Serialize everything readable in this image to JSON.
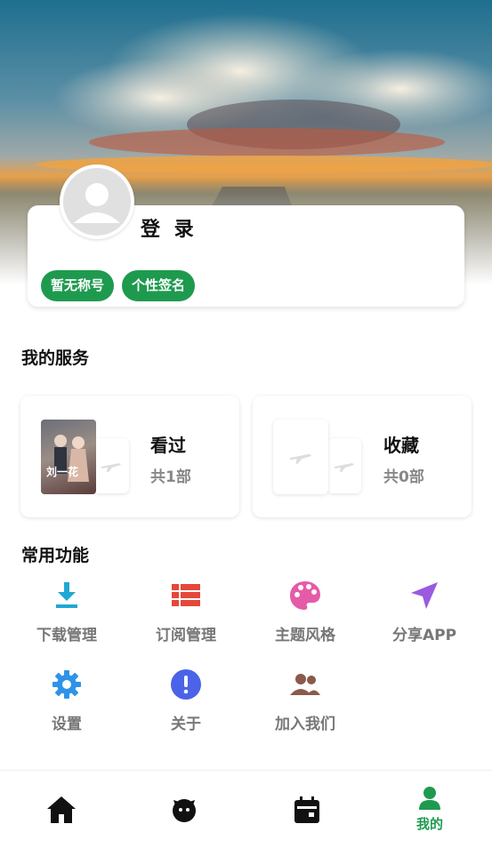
{
  "profile": {
    "login_label": "登 录",
    "chips": [
      "暂无称号",
      "个性签名"
    ]
  },
  "services": {
    "title": "我的服务",
    "items": [
      {
        "label": "看过",
        "count": "共1部",
        "poster_text": "刘一花"
      },
      {
        "label": "收藏",
        "count": "共0部"
      }
    ]
  },
  "functions": {
    "title": "常用功能",
    "items": [
      {
        "label": "下载管理",
        "icon": "download-icon",
        "color": "#1fa8d4"
      },
      {
        "label": "订阅管理",
        "icon": "list-icon",
        "color": "#e5483a"
      },
      {
        "label": "主题风格",
        "icon": "palette-icon",
        "color": "#e55ba8"
      },
      {
        "label": "分享APP",
        "icon": "send-icon",
        "color": "#9a5ae0"
      },
      {
        "label": "设置",
        "icon": "gear-icon",
        "color": "#2e93e8"
      },
      {
        "label": "关于",
        "icon": "info-icon",
        "color": "#4a63e8"
      },
      {
        "label": "加入我们",
        "icon": "group-icon",
        "color": "#8a5a4a"
      }
    ]
  },
  "bottom_nav": {
    "items": [
      {
        "icon": "home-icon",
        "label": ""
      },
      {
        "icon": "face-icon",
        "label": ""
      },
      {
        "icon": "calendar-icon",
        "label": ""
      },
      {
        "icon": "person-icon",
        "label": "我的",
        "active": true
      }
    ],
    "active_color": "#1e9a4f"
  }
}
